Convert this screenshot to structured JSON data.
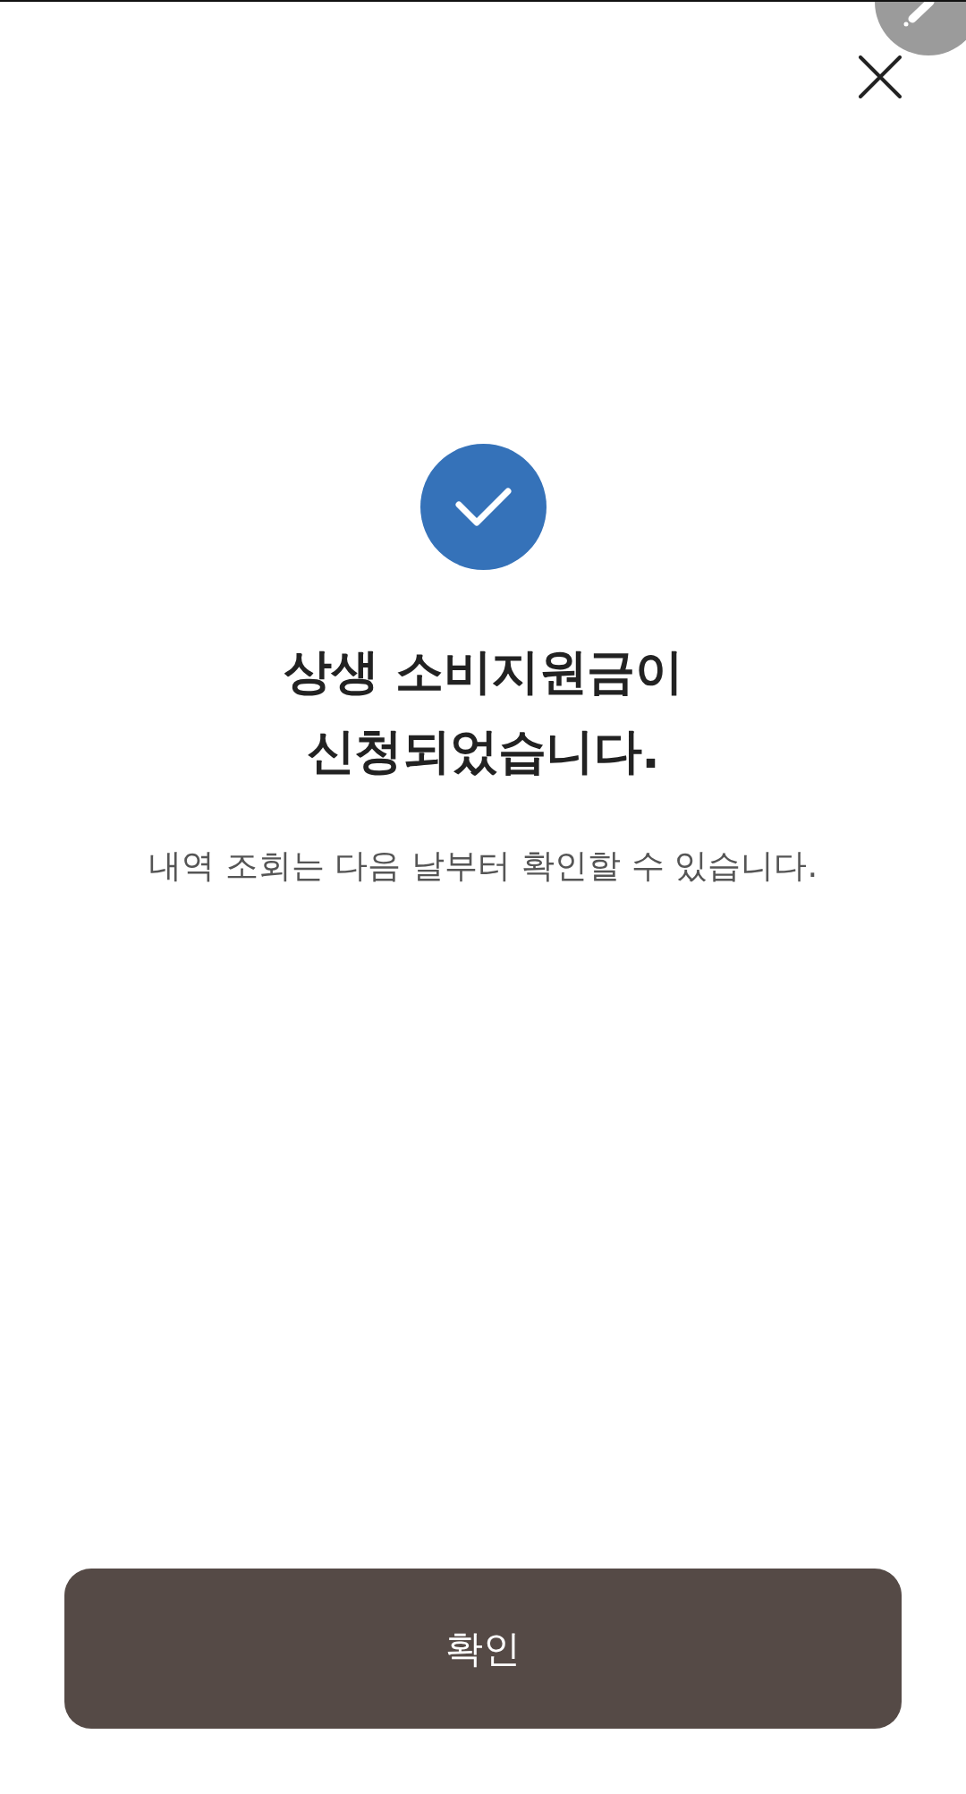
{
  "title": "상생 소비지원금이\n신청되었습니다.",
  "message": "내역 조회는 다음 날부터 확인할 수 있습니다.",
  "confirm_button": {
    "label": "확인"
  }
}
